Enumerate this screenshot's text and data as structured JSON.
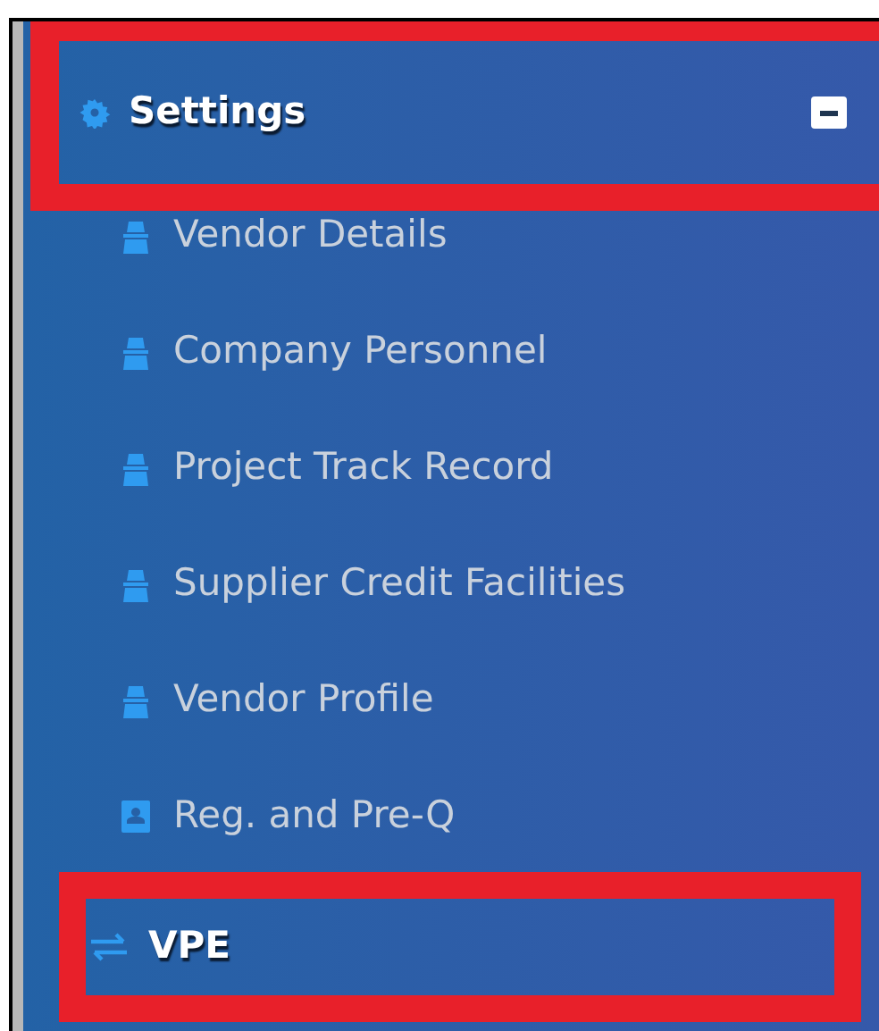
{
  "menu": {
    "header": {
      "label": "Settings",
      "expanded": true,
      "highlighted": true
    },
    "items": [
      {
        "label": "Vendor Details",
        "kind": "person",
        "selected": false,
        "highlighted": false
      },
      {
        "label": "Company Personnel",
        "kind": "person",
        "selected": false,
        "highlighted": false
      },
      {
        "label": "Project Track Record",
        "kind": "person",
        "selected": false,
        "highlighted": false
      },
      {
        "label": "Supplier Credit Facilities",
        "kind": "person",
        "selected": false,
        "highlighted": false
      },
      {
        "label": "Vendor Profile",
        "kind": "person",
        "selected": false,
        "highlighted": false
      },
      {
        "label": "Reg. and Pre-Q",
        "kind": "card",
        "selected": false,
        "highlighted": false
      },
      {
        "label": "VPE",
        "kind": "arrows",
        "selected": true,
        "highlighted": true
      }
    ]
  }
}
